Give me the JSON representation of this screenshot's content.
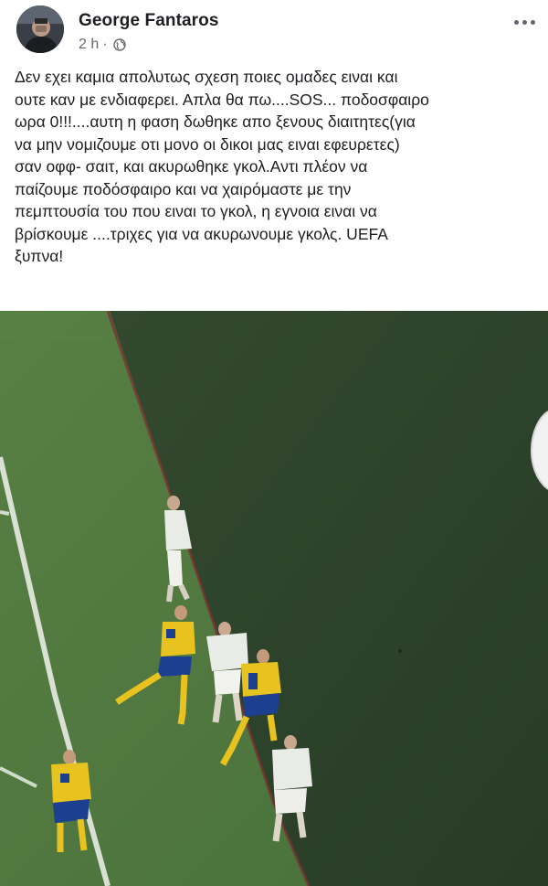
{
  "post": {
    "author": "George Fantaros",
    "time": "2 h",
    "separator": "·",
    "privacy_icon": "globe-icon",
    "more_icon": "more-options-icon",
    "text": "Δεν εχει καμια απολυτως σχεση ποιες ομαδες ειναι και\nουτε καν με ενδιαφερει. Απλα θα πω....SOS... ποδοσφαιρο\nωρα 0!!!....αυτη η φαση δωθηκε απο ξενους διαιτητες(για\nνα μην νομιζουμε οτι μονο οι δικοι μας ειναι εφευρετες)\nσαν οφφ- σαιτ, και ακυρωθηκε γκολ.Αντι πλέον να\nπαίζουμε ποδόσφαιρο και να χαιρόμαστε με την\nπεμπτουσία του που ειναι το γκολ, η εγνοια ειναι να\nβρίσκουμε ....τριχες για να ακυρωνουμε γκολς. UEFA\nξυπνα!",
    "photo": {
      "description_icon": "football-match-photo",
      "colors": {
        "pitch_light": "#4f7a3a",
        "pitch_dark": "#2f4a2a",
        "yellow_kit": "#e8c21e",
        "blue_kit": "#1d3f8f",
        "white_kit": "#e9ece6"
      }
    }
  }
}
